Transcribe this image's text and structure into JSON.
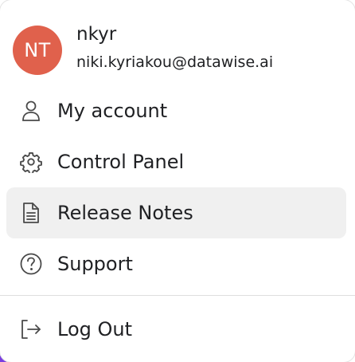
{
  "profile": {
    "initials": "NT",
    "name": "nkyr",
    "email": "niki.kyriakou@datawise.ai",
    "avatar_color": "#e0614c"
  },
  "menu": {
    "items": [
      {
        "label": "My account",
        "icon": "user-icon"
      },
      {
        "label": "Control Panel",
        "icon": "gear-icon"
      },
      {
        "label": "Release Notes",
        "icon": "document-icon",
        "active": true
      },
      {
        "label": "Support",
        "icon": "help-circle-icon"
      }
    ],
    "logout": {
      "label": "Log Out",
      "icon": "logout-icon"
    }
  },
  "colors": {
    "active_bg": "#f0f0f0",
    "text": "#202124",
    "icon": "#4a4a4a"
  }
}
